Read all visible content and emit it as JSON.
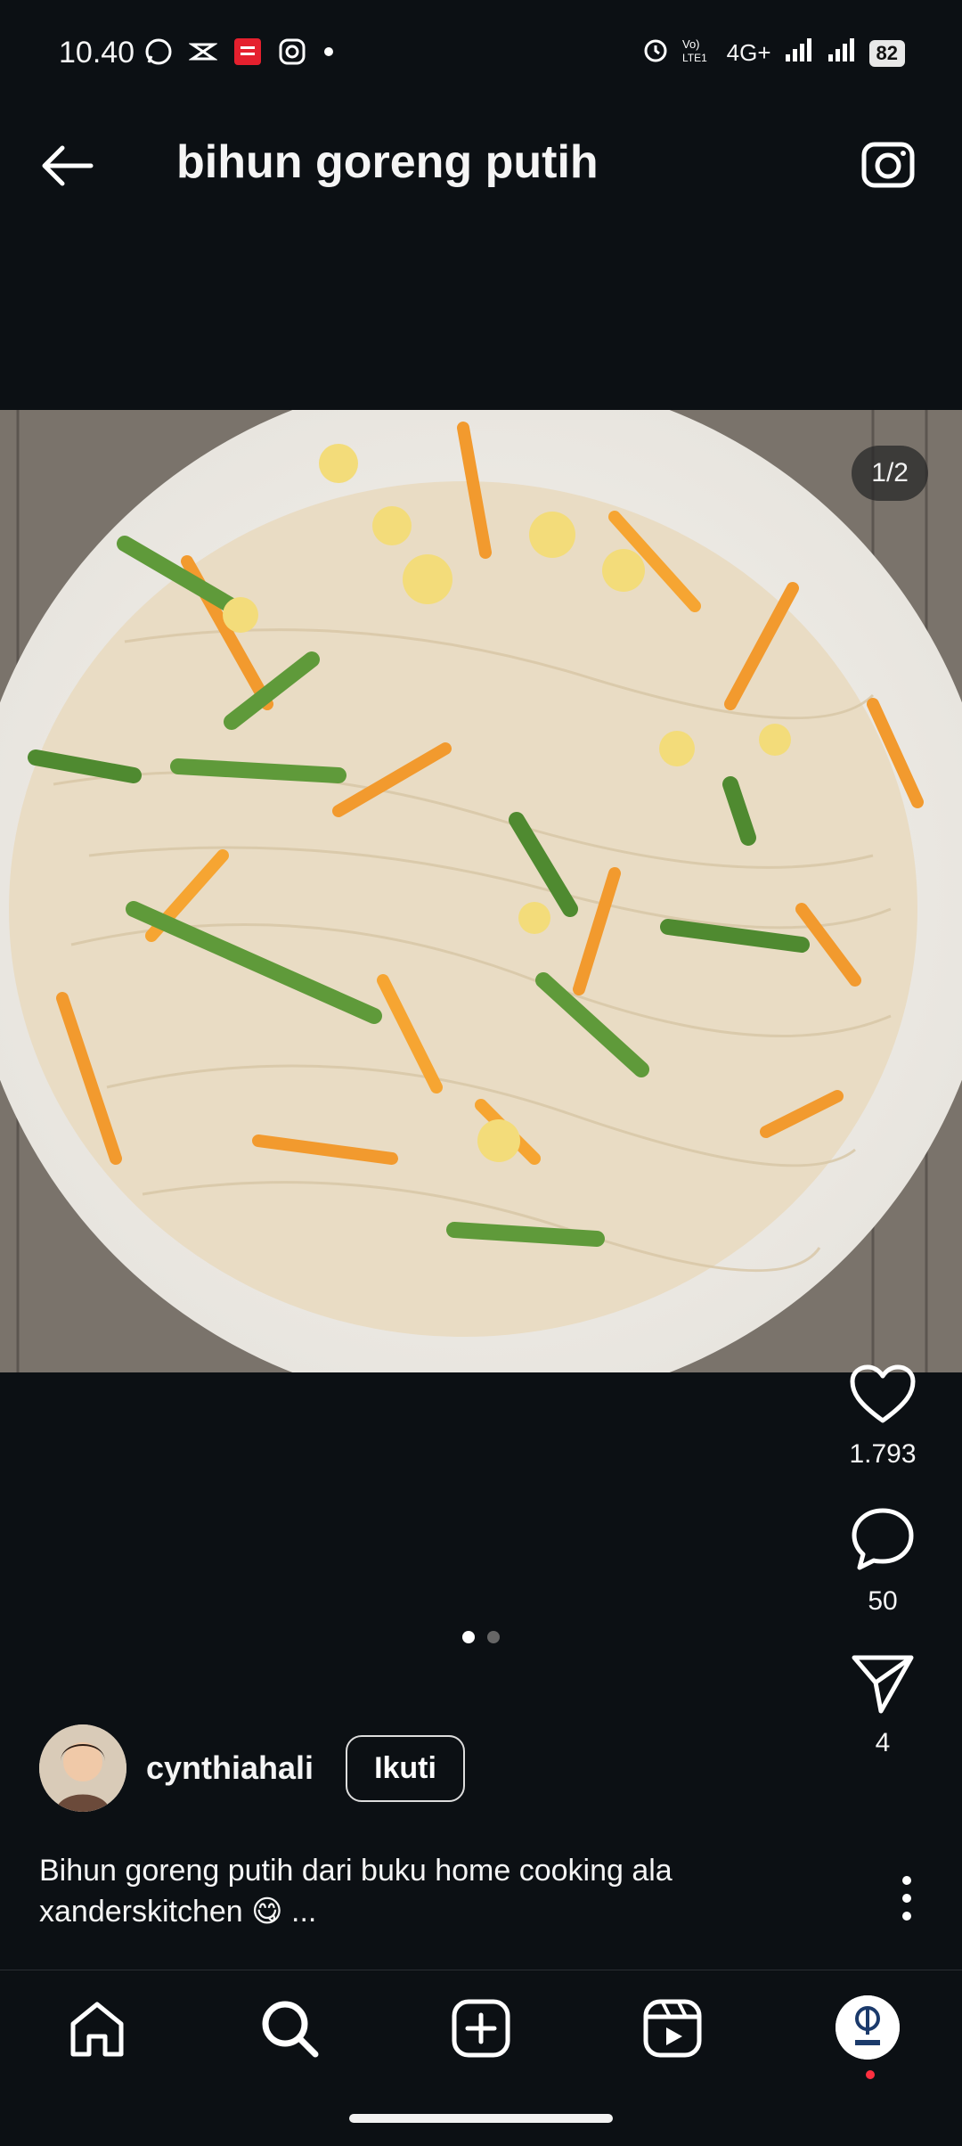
{
  "status_bar": {
    "time": "10.40",
    "network": "4G+",
    "battery": "82"
  },
  "header": {
    "title": "bihun goreng putih",
    "back_icon": "arrow-left-icon",
    "camera_icon": "camera-icon"
  },
  "post": {
    "image_counter": "1/2",
    "image_description": "Fried rice vermicelli with egg, carrot and green beans on a white plate",
    "likes": "1.793",
    "comments": "50",
    "shares": "4",
    "carousel_page": 1,
    "carousel_total": 2,
    "author": {
      "username": "cynthiahali",
      "follow_label": "Ikuti"
    },
    "caption": "Bihun goreng putih dari buku home cooking ala xanderskitchen 😋 ..."
  },
  "nav": {
    "items": [
      "home-icon",
      "search-icon",
      "create-icon",
      "reels-icon",
      "profile-avatar"
    ]
  },
  "colors": {
    "background": "#0c1014",
    "text": "#f5f5f5",
    "notification": "#ff3040"
  }
}
